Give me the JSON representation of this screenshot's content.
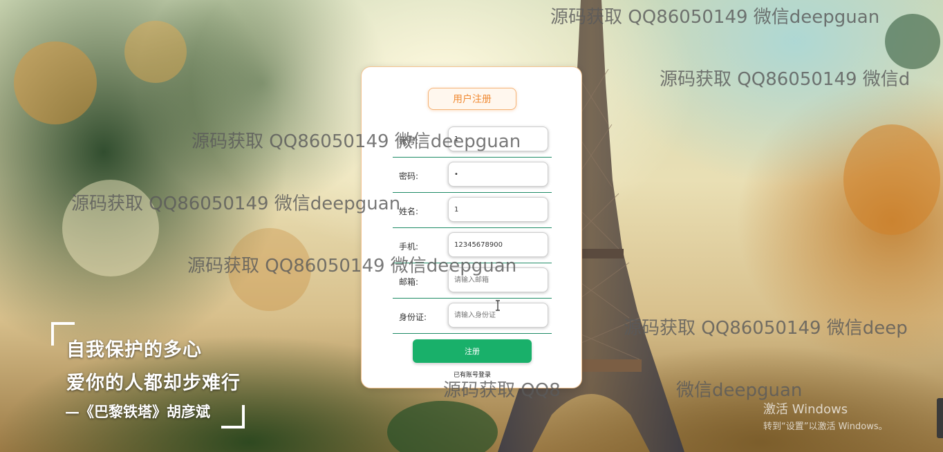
{
  "register_form": {
    "title": "用户注册",
    "fields": [
      {
        "label": "账号:",
        "value": "1",
        "placeholder": ""
      },
      {
        "label": "密码:",
        "value": "•",
        "placeholder": ""
      },
      {
        "label": "姓名:",
        "value": "1",
        "placeholder": ""
      },
      {
        "label": "手机:",
        "value": "12345678900",
        "placeholder": ""
      },
      {
        "label": "邮箱:",
        "value": "",
        "placeholder": "请输入邮箱"
      },
      {
        "label": "身份证:",
        "value": "",
        "placeholder": "请输入身份证"
      }
    ],
    "submit_label": "注册",
    "login_link": "已有账号登录"
  },
  "quote": {
    "line1": "自我保护的多心",
    "line2": "爱你的人都却步难行",
    "line3": "—《巴黎铁塔》胡彦斌"
  },
  "watermark_text": "源码获取 QQ86050149 微信deepguan",
  "watermark_partial": "源码获取 QQ86050149 微信deep",
  "watermark_cut1": "源码获取 QQ86050149 微信d",
  "watermark_cut2": "源码获取 QQ8",
  "watermark_cut3": "微信deepguan",
  "windows_activation": {
    "title": "激活 Windows",
    "subtitle": "转到“设置”以激活 Windows。"
  },
  "colors": {
    "accent_orange": "#f08a33",
    "button_green": "#19b06a",
    "divider_green": "#1c8a64"
  }
}
